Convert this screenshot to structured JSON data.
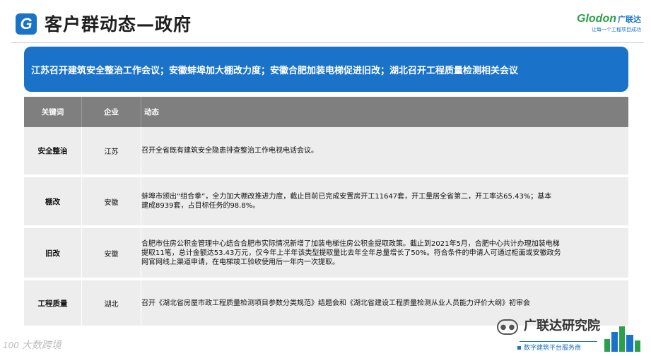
{
  "header": {
    "logo_letter": "G",
    "title": "客户群动态—政府"
  },
  "brand": {
    "name": "Glodon",
    "name_cn": "广联达",
    "slogan": "让每一个工程项目成功"
  },
  "banner": {
    "text": "江苏召开建筑安全整治工作会议；安徽蚌埠加大棚改力度；安徽合肥加装电梯促进旧改；湖北召开工程质量检测相关会议"
  },
  "table": {
    "headers": [
      "关键词",
      "企业",
      "动态"
    ],
    "rows": [
      {
        "keyword": "安全整治",
        "region": "江苏",
        "lines": [
          "召开全省既有建筑安全隐患排查整治工作电视电话会议。"
        ]
      },
      {
        "keyword": "棚改",
        "region": "安徽",
        "lines": [
          "蚌埠市颁出“组合拳”，全力加大棚改推进力度，截止目前已完成安置房开工11647套，开工量居全省第二，开工率达65.43%；基本",
          "建成8939套，占目标任务的98.8%。"
        ]
      },
      {
        "keyword": "旧改",
        "region": "安徽",
        "lines": [
          "合肥市住房公积金管理中心结合合肥市实际情况新增了加装电梯住房公积金提取政策。截止到2021年5月，合肥中心共计办理加装电梯",
          "提取11笔，总计金额达53.43万元，仅今年上半年该类型提取量比去年全年总量增长了50%。符合条件的申请人可通过柜面或安徽政务",
          "网官网线上渠道申请，在电梯竣工验收使用后一年内一次提取。"
        ]
      },
      {
        "keyword": "工程质量",
        "region": "湖北",
        "lines": [
          "召开《湖北省房屋市政工程质量检测项目参数分类规范》结题会和《湖北省建设工程质量检测从业人员能力评价大纲》初审会"
        ]
      }
    ]
  },
  "watermark": {
    "left_num": "100",
    "left_text": "大数跨境",
    "wechat_name": "广联达研究院",
    "footer": "数字建筑平台服务商"
  },
  "colors": {
    "accent": "#1a73c8",
    "header_gray": "#7f7f7f",
    "row_gray": "#ededed",
    "brand_green": "#2aa04a"
  }
}
